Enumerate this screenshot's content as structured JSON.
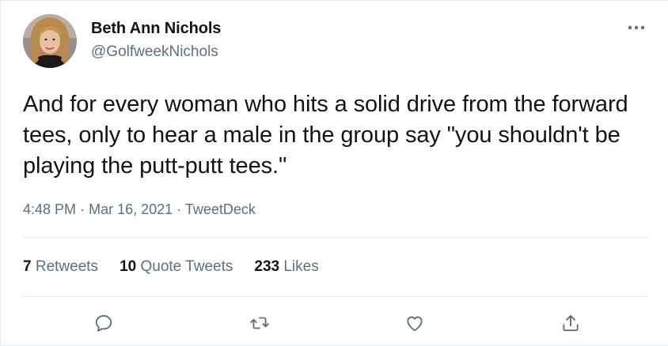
{
  "tweet": {
    "author_name": "Beth Ann Nichols",
    "author_handle": "@GolfweekNichols",
    "text": "And for every woman who hits a solid drive from the forward tees, only to hear a male in the group say \"you shouldn't be playing the putt-putt tees.\"",
    "time": "4:48 PM",
    "separator": "·",
    "date": "Mar 16, 2021",
    "source": "TweetDeck"
  },
  "stats": {
    "retweets_count": "7",
    "retweets_label": "Retweets",
    "quotes_count": "10",
    "quotes_label": "Quote Tweets",
    "likes_count": "233",
    "likes_label": "Likes"
  },
  "actions": {
    "reply_icon": "reply-icon",
    "retweet_icon": "retweet-icon",
    "like_icon": "heart-icon",
    "share_icon": "share-icon"
  },
  "colors": {
    "text_primary": "#0f1419",
    "text_secondary": "#5b7083",
    "divider": "#e6ecf0"
  }
}
